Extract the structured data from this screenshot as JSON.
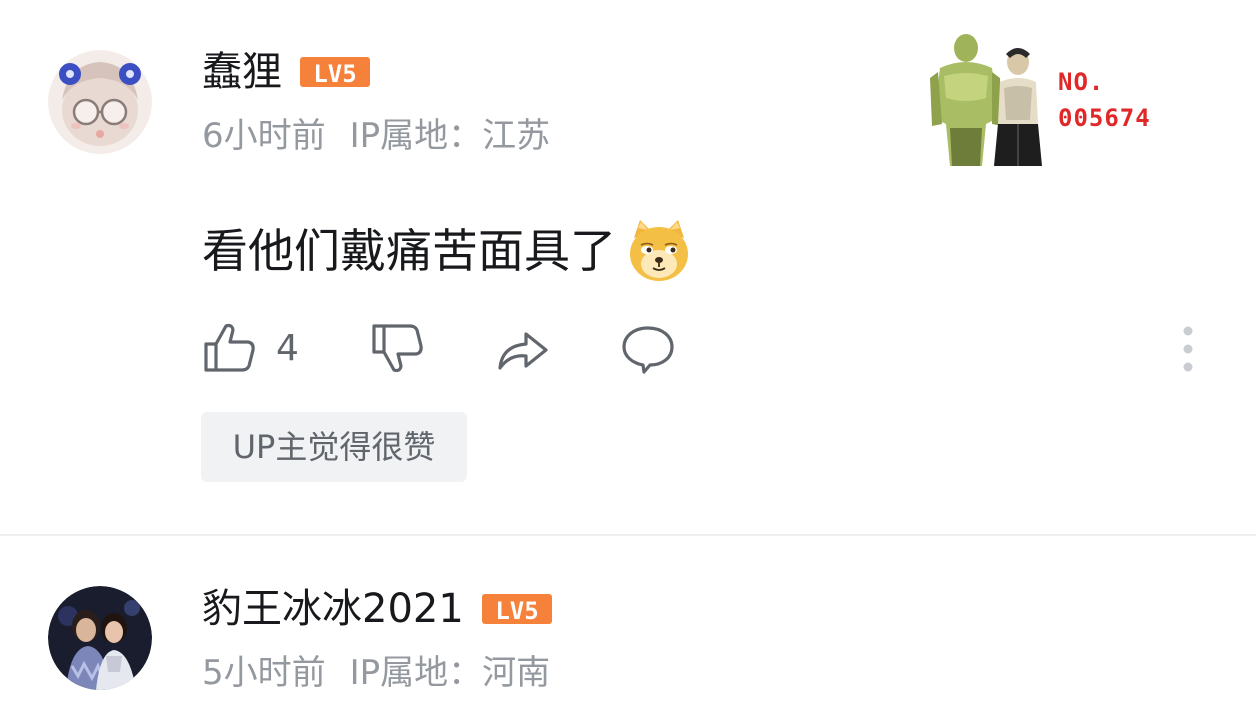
{
  "comments": [
    {
      "username": "蠢狸",
      "level": "LV5",
      "time": "6小时前",
      "ip_location": "IP属地：江苏",
      "content": "看他们戴痛苦面具了",
      "emoji": "doge-emoji",
      "like_count": "4",
      "up_liked_label": "UP主觉得很赞",
      "decoration": {
        "no_label": "NO.",
        "number": "005674"
      }
    },
    {
      "username": "豹王冰冰2021",
      "level": "LV5",
      "time": "5小时前",
      "ip_location": "IP属地：河南"
    }
  ],
  "icons": {
    "like": "thumbs-up-icon",
    "dislike": "thumbs-down-icon",
    "share": "share-icon",
    "reply": "comment-bubble-icon",
    "more": "more-vertical-icon"
  },
  "colors": {
    "level_badge": "#f5813a",
    "text_primary": "#18191c",
    "text_secondary": "#9499a0",
    "icon": "#61666d",
    "tag_bg": "#f1f2f3",
    "decoration_number": "#e02828"
  }
}
